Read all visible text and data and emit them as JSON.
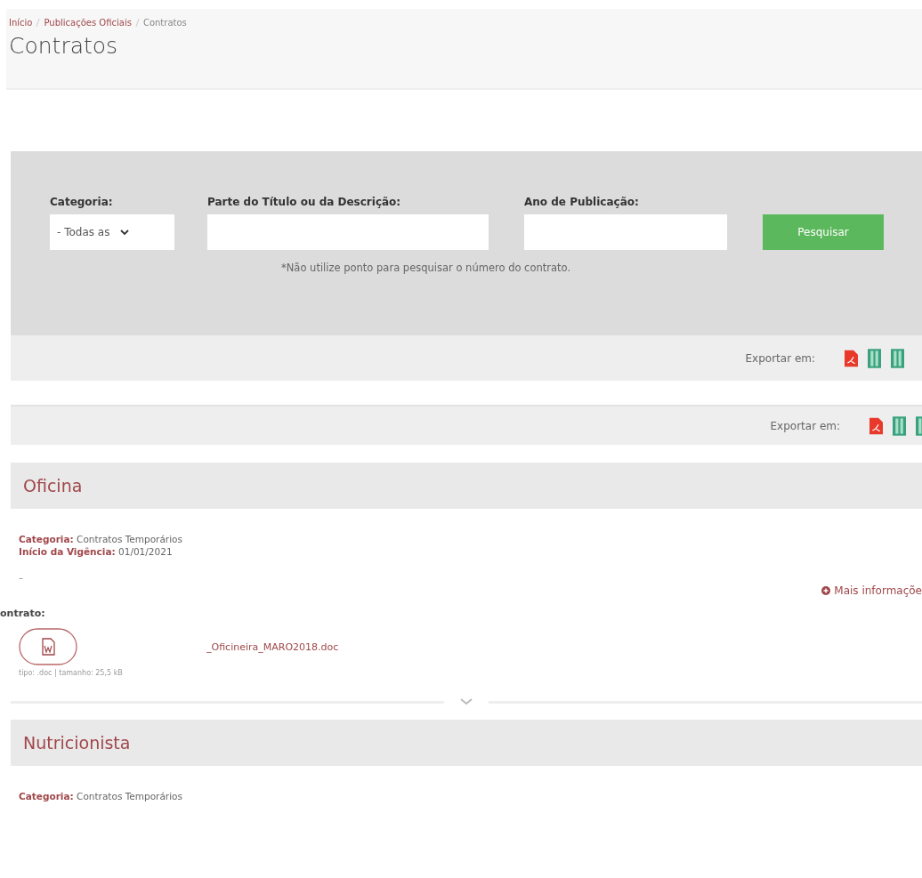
{
  "breadcrumb": [
    {
      "label": "Início",
      "kind": "link"
    },
    {
      "label": "Publicações Oficiais",
      "kind": "link"
    },
    {
      "label": "Contratos",
      "kind": "current"
    }
  ],
  "title": "Contratos",
  "filters": {
    "category": {
      "label": "Categoria:",
      "value": "- Todas as"
    },
    "text": {
      "label": "Parte do Título ou da Descrição:"
    },
    "year": {
      "label": "Ano de Publicação:"
    },
    "button": "Pesquisar",
    "hint": "*Não utilize ponto para pesquisar o número do contrato."
  },
  "export_bars": [
    {
      "label": "Exportar em:",
      "formats": [
        {
          "kind": "pdf"
        },
        {
          "kind": "sheet"
        },
        {
          "kind": "sheet"
        }
      ]
    },
    {
      "label": "Exportar em:",
      "formats": [
        {
          "kind": "pdf"
        },
        {
          "kind": "sheet"
        },
        {
          "kind": "sheet"
        }
      ]
    }
  ],
  "contracts": [
    {
      "title": "Oficina",
      "fields": [
        {
          "label": "Categoria:",
          "value": "Contratos Temporários"
        },
        {
          "label": "Início da Vigência:",
          "value": "01/01/2021"
        }
      ],
      "note": "–",
      "more": "Mais informaçõe",
      "file_heading": "ontrato:",
      "file": {
        "name": "_Oficineira_MARO2018.doc",
        "meta": "tipo: .doc | tamanho: 25,5 kB"
      }
    },
    {
      "title": "Nutricionista",
      "fields": [
        {
          "label": "Categoria:",
          "value": "Contratos Temporários"
        }
      ]
    }
  ]
}
